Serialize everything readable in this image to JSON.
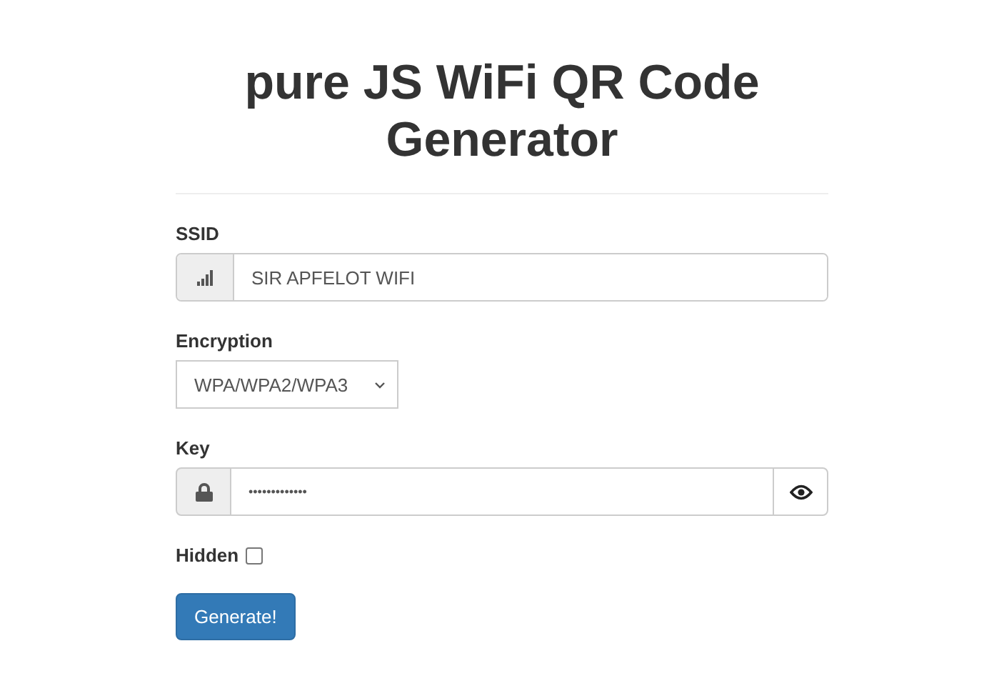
{
  "title": "pure JS WiFi QR Code Generator",
  "ssid": {
    "label": "SSID",
    "value": "SIR APFELOT WIFI"
  },
  "encryption": {
    "label": "Encryption",
    "value": "WPA/WPA2/WPA3"
  },
  "key": {
    "label": "Key",
    "value": "•••••••••••••"
  },
  "hidden": {
    "label": "Hidden",
    "checked": false
  },
  "button": "Generate!"
}
